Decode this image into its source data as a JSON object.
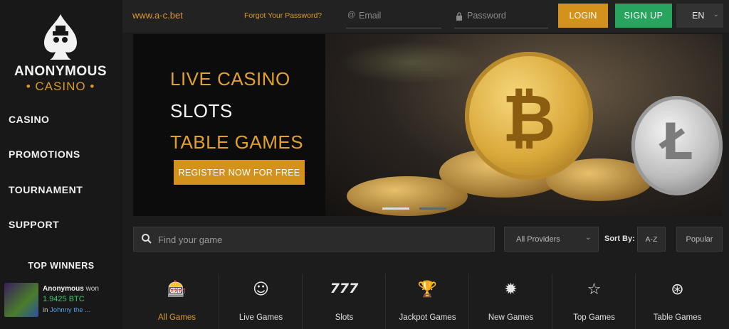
{
  "brand": {
    "name": "ANONYMOUS",
    "sub": "CASINO"
  },
  "sidebar": {
    "items": [
      {
        "label": "CASINO"
      },
      {
        "label": "PROMOTIONS"
      },
      {
        "label": "TOURNAMENT"
      },
      {
        "label": "SUPPORT"
      }
    ],
    "top_winners": {
      "title": "TOP WINNERS",
      "name": "Anonymous",
      "won_text": "won",
      "amount": "1.9425 BTC",
      "in_text": "in",
      "game": "Johnny the ..."
    }
  },
  "header": {
    "site_url": "www.a-c.bet",
    "forgot_password": "Forgot Your Password?",
    "email_placeholder": "Email",
    "password_placeholder": "Password",
    "login_label": "LOGIN",
    "signup_label": "SIGN UP",
    "language": "EN"
  },
  "banner": {
    "line1": "LIVE CASINO",
    "line2": "SLOTS",
    "line3": "TABLE GAMES",
    "cta": "REGISTER NOW FOR FREE"
  },
  "filters": {
    "search_placeholder": "Find your game",
    "provider": "All Providers",
    "sort_by_label": "Sort By:",
    "sort_az": "A-Z",
    "sort_popular": "Popular"
  },
  "categories": [
    {
      "label": "All Games",
      "icon": "slot-machine-icon"
    },
    {
      "label": "Live Games",
      "icon": "dealer-icon"
    },
    {
      "label": "Slots",
      "icon": "triple-seven-icon"
    },
    {
      "label": "Jackpot Games",
      "icon": "trophy-icon"
    },
    {
      "label": "New Games",
      "icon": "new-badge-icon"
    },
    {
      "label": "Top Games",
      "icon": "star-icon"
    },
    {
      "label": "Table Games",
      "icon": "roulette-icon"
    }
  ],
  "colors": {
    "accent": "#d3921c",
    "signup": "#27a55e",
    "winner_amount": "#3cc86a",
    "winner_game": "#4fa0e8"
  }
}
